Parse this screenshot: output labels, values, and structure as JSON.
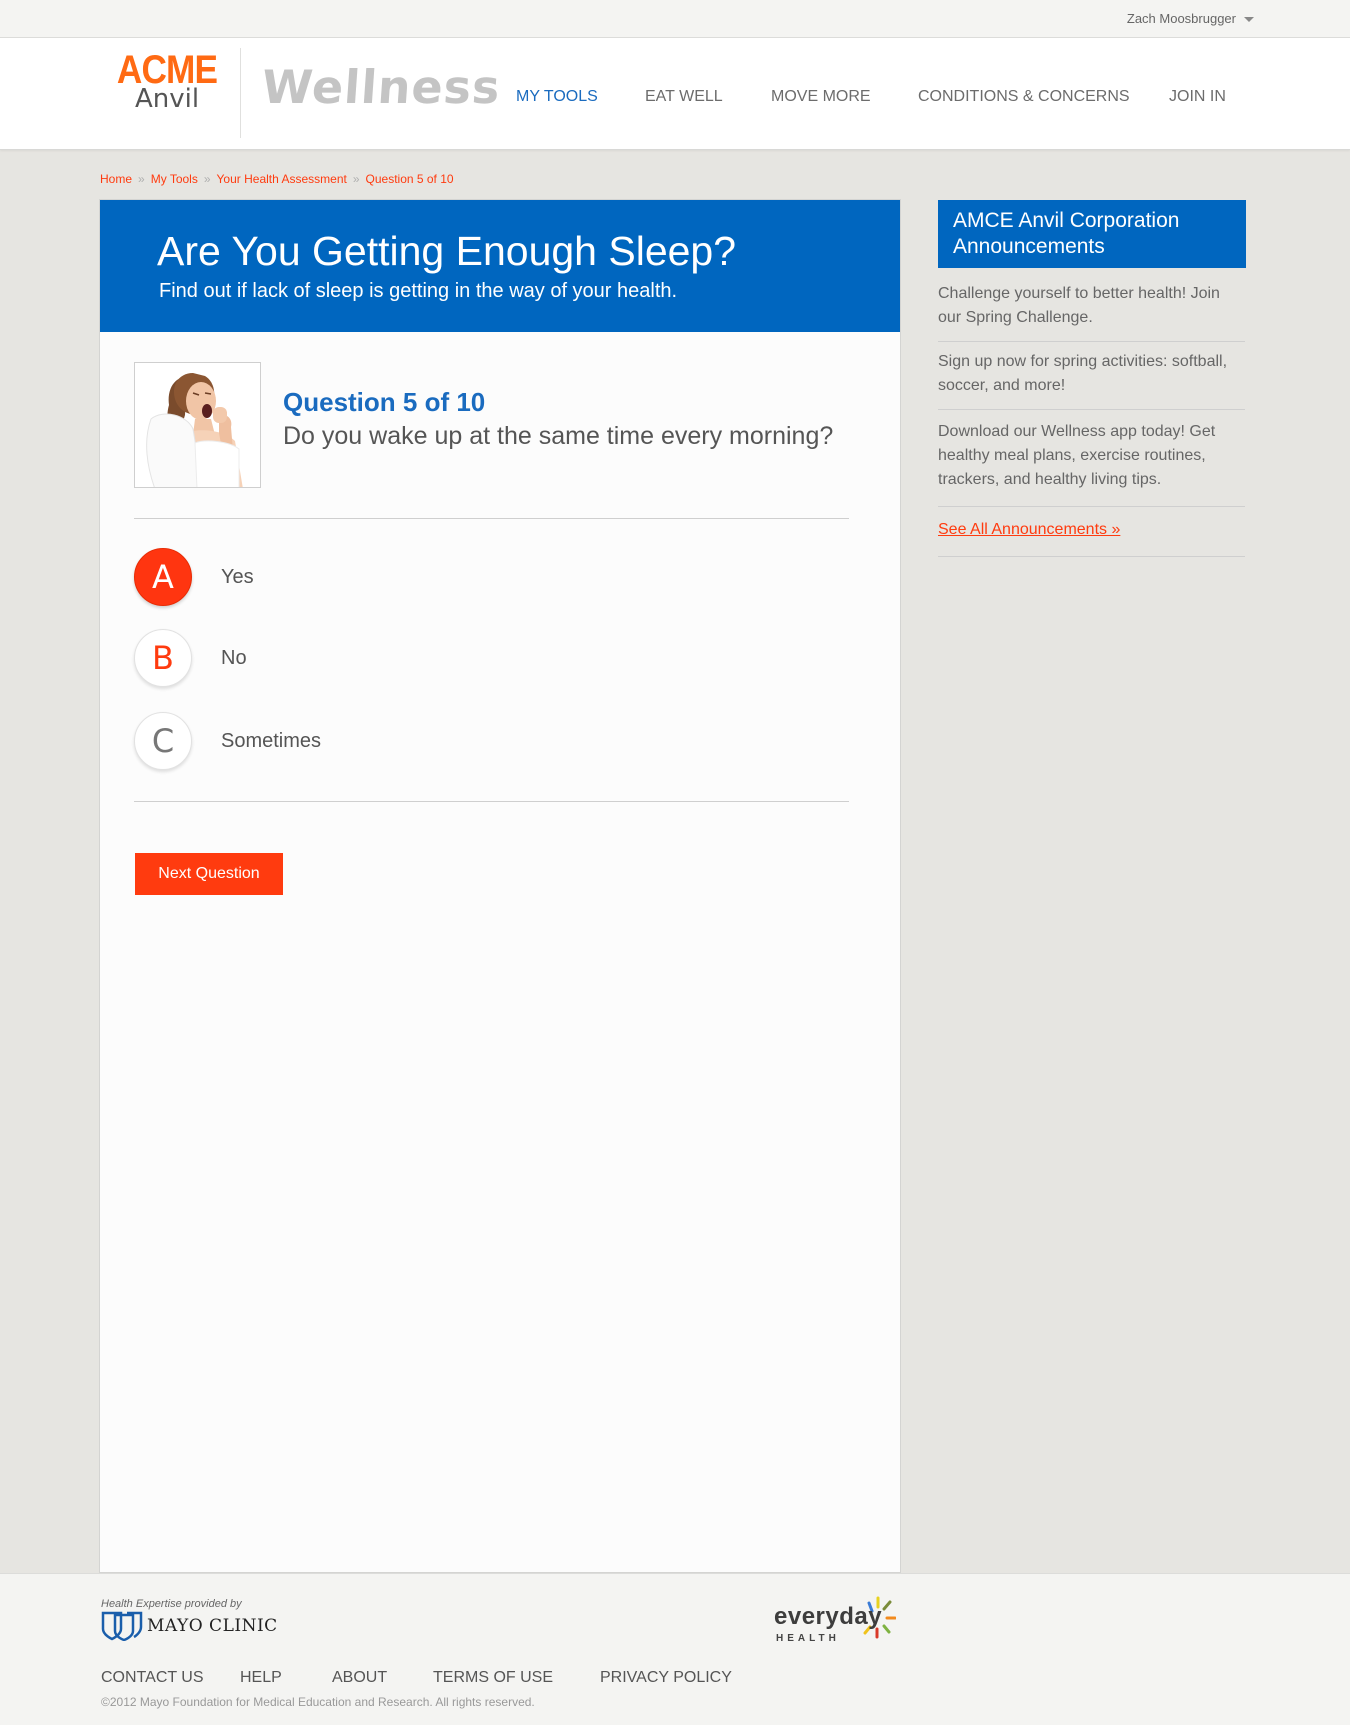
{
  "user": {
    "name": "Zach Moosbrugger"
  },
  "logo": {
    "brand_top": "ACME",
    "brand_bottom": "Anvil",
    "product": "Wellness"
  },
  "nav": [
    {
      "label": "MY TOOLS",
      "active": true
    },
    {
      "label": "EAT WELL",
      "active": false
    },
    {
      "label": "MOVE MORE",
      "active": false
    },
    {
      "label": "CONDITIONS & CONCERNS",
      "active": false
    },
    {
      "label": "JOIN IN",
      "active": false
    }
  ],
  "breadcrumb": [
    "Home",
    "My Tools",
    "Your Health Assessment",
    "Question 5 of 10"
  ],
  "hero": {
    "title": "Are You Getting Enough Sleep?",
    "subtitle": "Find out if lack of sleep is getting in the way of your health."
  },
  "question": {
    "number": "Question 5 of 10",
    "text": "Do you wake up at the same time every morning?",
    "answers": [
      {
        "letter": "A",
        "label": "Yes",
        "selected": true
      },
      {
        "letter": "B",
        "label": "No",
        "selected": false
      },
      {
        "letter": "C",
        "label": "Sometimes",
        "selected": false
      }
    ],
    "next_label": "Next Question"
  },
  "sidebar": {
    "heading_line1": "AMCE Anvil Corporation",
    "heading_line2": "Announcements",
    "items": [
      "Challenge yourself to better health! Join our Spring Challenge.",
      "Sign up now for spring activities: softball, soccer, and more!",
      "Download our Wellness app today! Get healthy meal plans, exercise routines, trackers, and healthy living tips."
    ],
    "see_all": "See All Announcements »"
  },
  "footer": {
    "mayo_tag": "Health Expertise provided by",
    "mayo_name": "MAYO CLINIC",
    "everyday_word": "everyday",
    "everyday_sub": "HEALTH",
    "links": [
      "CONTACT US",
      "HELP",
      "ABOUT",
      "TERMS OF USE",
      "PRIVACY POLICY"
    ],
    "copyright": "©2012 Mayo Foundation for Medical Education and Research. All rights reserved."
  },
  "colors": {
    "brand_orange": "#ff6a13",
    "accent_red": "#ff3b0f",
    "primary_blue": "#0066bf",
    "link_blue": "#1a6bbf"
  }
}
